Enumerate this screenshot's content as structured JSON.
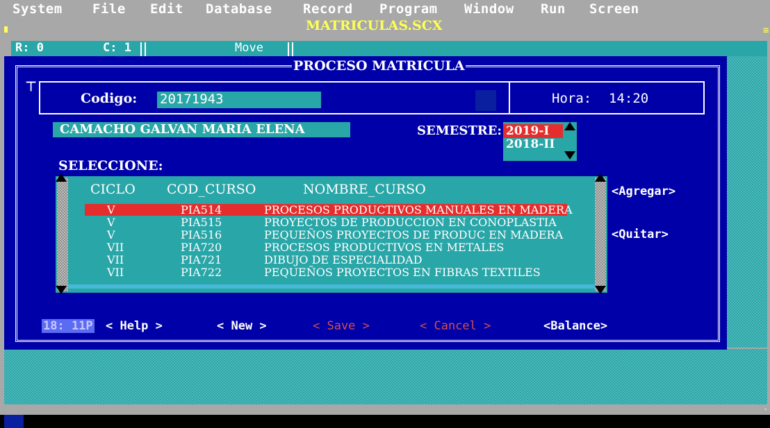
{
  "menu": [
    "System",
    "File",
    "Edit",
    "Database",
    "Record",
    "Program",
    "Window",
    "Run",
    "Screen"
  ],
  "window_title": "MATRICULAS.SCX",
  "status": {
    "row": "R:  0",
    "col": "C:  1",
    "mode": "Move"
  },
  "dialog": {
    "title": "PROCESO MATRICULA",
    "codigo_label": "Codigo:",
    "codigo_value": "20171943",
    "hora_label": "Hora:",
    "hora_value": "14:20",
    "student_name": "CAMACHO GALVAN MARIA ELENA",
    "semestre_label": "SEMESTRE:",
    "semestre_options": [
      "2019-I",
      "2018-II"
    ],
    "semestre_selected": "2019-I",
    "seleccione_label": "SELECCIONE:",
    "columns": [
      "CICLO",
      "COD_CURSO",
      "NOMBRE_CURSO"
    ],
    "courses": [
      [
        "V",
        "PIA514",
        "PROCESOS PRODUCTIVOS MANUALES EN MADERA"
      ],
      [
        "V",
        "PIA515",
        "PROYECTOS DE PRODUCCION EN CONOPLASTIA"
      ],
      [
        "V",
        "PIA516",
        "PEQUEÑOS PROYECTOS DE PRODUC EN MADERA"
      ],
      [
        "VII",
        "PIA720",
        "PROCESOS PRODUCTIVOS EN METALES"
      ],
      [
        "VII",
        "PIA721",
        "DIBUJO DE ESPECIALIDAD"
      ],
      [
        "VII",
        "PIA722",
        "PEQUEÑOS PROYECTOS EN FIBRAS TEXTILES"
      ]
    ],
    "agregar": "<Agregar>",
    "quitar": "<Quitar>"
  },
  "buttons": {
    "clock": "18: 11P",
    "help": "< Help >",
    "new": "< New >",
    "save": "< Save >",
    "cancel": "< Cancel >",
    "balance": "<Balance>"
  },
  "colors": {
    "desktop_bg": "#a8a8a8",
    "dialog_bg": "#0000a8",
    "field_bg": "#29a6a8",
    "selection": "#e52d2d",
    "hotkey": "#b31bb3",
    "title_yellow": "#ffff55"
  }
}
